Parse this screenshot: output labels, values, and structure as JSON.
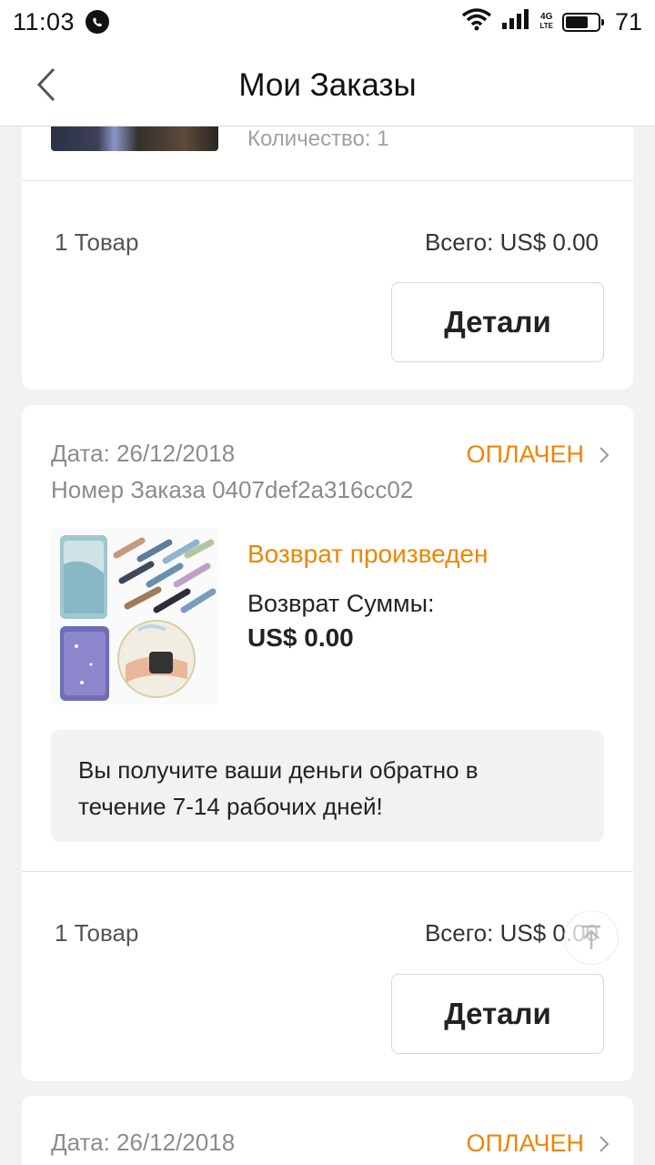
{
  "status_bar": {
    "time": "11:03",
    "network": "4G",
    "network_sub": "LTE",
    "battery": "71"
  },
  "header": {
    "title": "Мои Заказы"
  },
  "orders": [
    {
      "quantity": "Количество: 1",
      "items_count": "1 Товар",
      "total": "Всего: US$ 0.00",
      "details_label": "Детали"
    },
    {
      "date": "Дата: 26/12/2018",
      "status": "ОПЛАЧЕН",
      "order_number": "Номер Заказа 0407def2a316cc02",
      "refund_status": "Возврат произведен",
      "refund_label": "Возврат Суммы:",
      "refund_amount": "US$ 0.00",
      "notice_line1": "Вы получите ваши деньги обратно в",
      "notice_line2": "течение 7-14 рабочих дней!",
      "items_count": "1 Товар",
      "total": "Всего: US$ 0.00",
      "details_label": "Детали"
    },
    {
      "date": "Дата: 26/12/2018",
      "status": "ОПЛАЧЕН"
    }
  ],
  "colors": {
    "accent": "#f08400",
    "muted": "#8c8c8c",
    "background": "#f2f2f2"
  }
}
